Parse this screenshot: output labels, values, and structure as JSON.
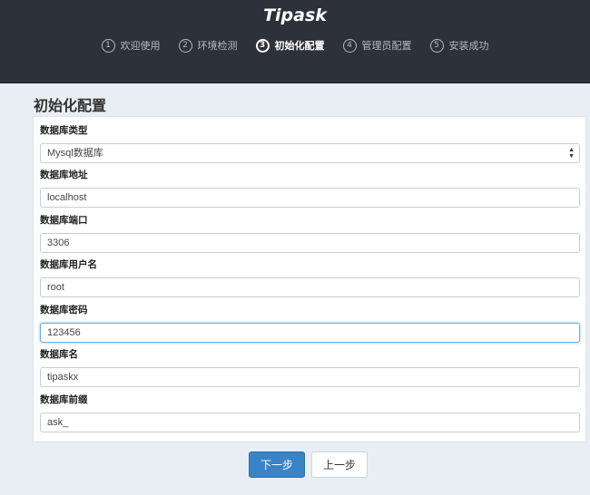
{
  "header": {
    "brand": "Tipask",
    "steps": [
      {
        "num": "1",
        "label": "欢迎使用"
      },
      {
        "num": "2",
        "label": "环境检测"
      },
      {
        "num": "3",
        "label": "初始化配置"
      },
      {
        "num": "4",
        "label": "管理员配置"
      },
      {
        "num": "5",
        "label": "安装成功"
      }
    ]
  },
  "main": {
    "title": "初始化配置",
    "fields": {
      "db_type": {
        "label": "数据库类型",
        "value": "Mysql数据库"
      },
      "db_host": {
        "label": "数据库地址",
        "value": "localhost"
      },
      "db_port": {
        "label": "数据库端口",
        "value": "3306"
      },
      "db_user": {
        "label": "数据库用户名",
        "value": "root"
      },
      "db_password": {
        "label": "数据库密码",
        "value": "123456"
      },
      "db_name": {
        "label": "数据库名",
        "value": "tipaskx"
      },
      "db_prefix": {
        "label": "数据库前缀",
        "value": "ask_"
      }
    },
    "buttons": {
      "next": "下一步",
      "prev": "上一步"
    }
  },
  "colors": {
    "header_bg": "#2c313a",
    "primary": "#3a83c7",
    "focus": "#66afe9"
  }
}
